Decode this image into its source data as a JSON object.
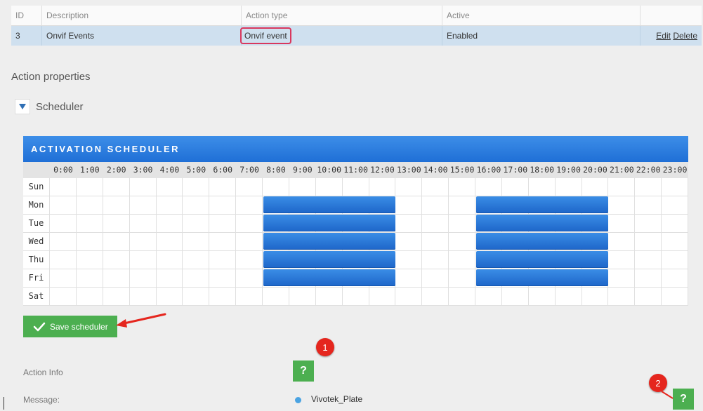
{
  "table": {
    "headers": [
      "ID",
      "Description",
      "Action type",
      "Active",
      ""
    ],
    "row": {
      "id": "3",
      "description": "Onvif Events",
      "action_type": "Onvif event",
      "active": "Enabled",
      "edit": "Edit",
      "delete": "Delete"
    }
  },
  "section_title": "Action properties",
  "scheduler_toggle": "Scheduler",
  "scheduler": {
    "title": "ACTIVATION SCHEDULER",
    "hours": [
      "0:00",
      "1:00",
      "2:00",
      "3:00",
      "4:00",
      "5:00",
      "6:00",
      "7:00",
      "8:00",
      "9:00",
      "10:00",
      "11:00",
      "12:00",
      "13:00",
      "14:00",
      "15:00",
      "16:00",
      "17:00",
      "18:00",
      "19:00",
      "20:00",
      "21:00",
      "22:00",
      "23:00"
    ],
    "days": [
      "Sun",
      "Mon",
      "Tue",
      "Wed",
      "Thu",
      "Fri",
      "Sat"
    ],
    "active_blocks": [
      {
        "day": "Mon",
        "from": "8:00",
        "to": "13:00"
      },
      {
        "day": "Mon",
        "from": "16:00",
        "to": "21:00"
      },
      {
        "day": "Tue",
        "from": "8:00",
        "to": "13:00"
      },
      {
        "day": "Tue",
        "from": "16:00",
        "to": "21:00"
      },
      {
        "day": "Wed",
        "from": "8:00",
        "to": "13:00"
      },
      {
        "day": "Wed",
        "from": "16:00",
        "to": "21:00"
      },
      {
        "day": "Thu",
        "from": "8:00",
        "to": "13:00"
      },
      {
        "day": "Thu",
        "from": "16:00",
        "to": "21:00"
      },
      {
        "day": "Fri",
        "from": "8:00",
        "to": "13:00"
      },
      {
        "day": "Fri",
        "from": "16:00",
        "to": "21:00"
      }
    ]
  },
  "save_button": "Save scheduler",
  "action_info_label": "Action Info",
  "message_label": "Message:",
  "help_label": "?",
  "badges": [
    "1",
    "2"
  ],
  "radio_option": "Vivotek_Plate",
  "colors": {
    "accent_blue": "#1f6fd6",
    "green": "#4caf50",
    "highlight_red": "#d9375d",
    "badge_red": "#e5261e"
  },
  "icons": [
    "triangle-down-icon",
    "checkmark-icon",
    "arrow-icon"
  ]
}
